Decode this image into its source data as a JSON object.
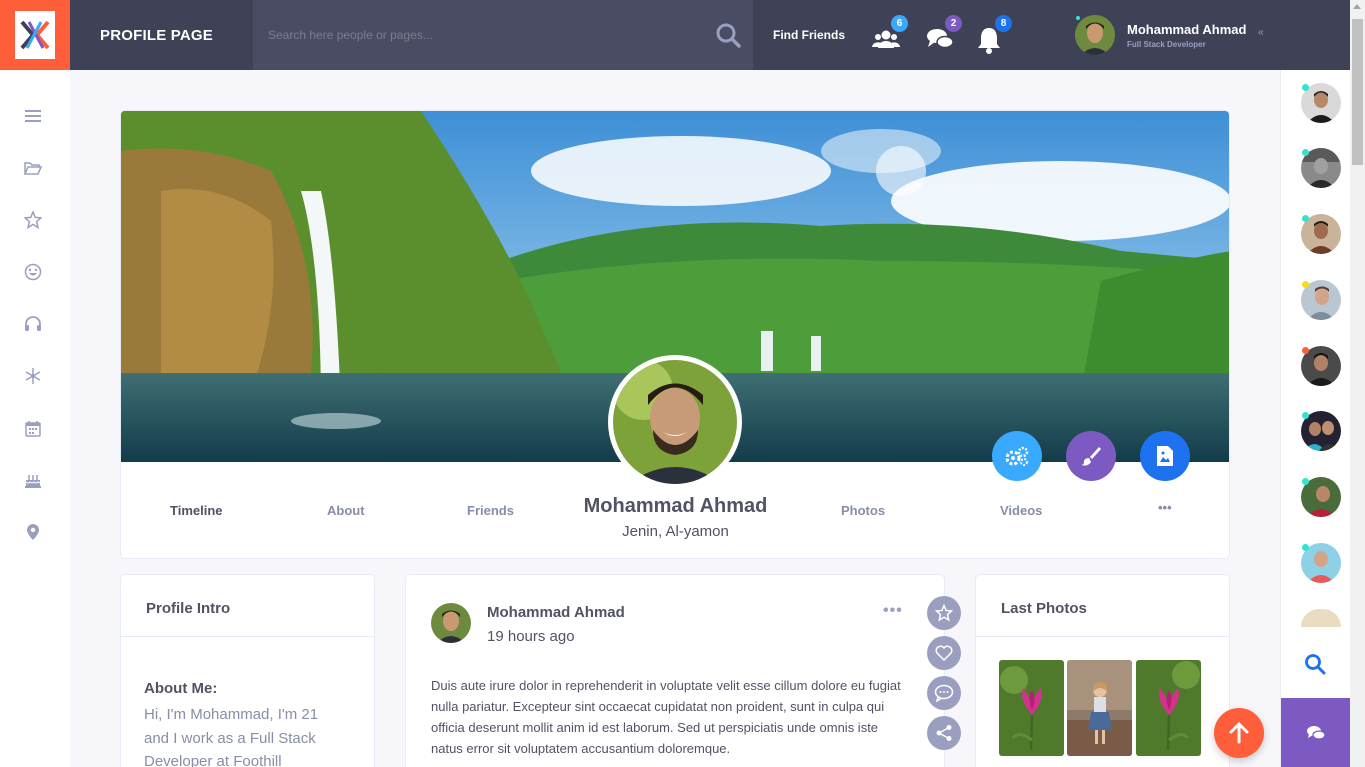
{
  "header": {
    "title": "PROFILE PAGE",
    "search_placeholder": "Search here people or pages...",
    "find_friends": "Find Friends",
    "badges": {
      "friends": "6",
      "messages": "2",
      "notifications": "8"
    },
    "user": {
      "name": "Mohammad Ahmad",
      "role": "Full Stack Developer",
      "chevron": "«"
    }
  },
  "left_sidebar": {
    "icons": [
      "menu-icon",
      "folder-icon",
      "star-icon",
      "smile-icon",
      "headphones-icon",
      "snowflake-icon",
      "calendar-icon",
      "cake-icon",
      "map-pin-icon"
    ]
  },
  "right_sidebar": {
    "status_colors": [
      "#32e4cd",
      "#32e4cd",
      "#32e4cd",
      "#ffd71b",
      "#ff5e3a",
      "#32e4cd",
      "#32e4cd",
      "#32e4cd"
    ]
  },
  "profile": {
    "name": "Mohammad Ahmad",
    "location": "Jenin, Al-yamon",
    "tabs": [
      "Timeline",
      "About",
      "Friends",
      "Photos",
      "Videos",
      "•••"
    ],
    "controls": [
      "settings-icon",
      "brush-icon",
      "image-file-icon"
    ]
  },
  "intro": {
    "title": "Profile Intro",
    "about_label": "About Me:",
    "about_text": "Hi, I'm Mohammad, I'm 21 and I work as a Full Stack Developer at Foothill"
  },
  "post": {
    "author": "Mohammad Ahmad",
    "time": "19 hours ago",
    "more": "•••",
    "text": "Duis aute irure dolor in reprehenderit in voluptate velit esse cillum dolore eu fugiat nulla pariatur. Excepteur sint occaecat cupidatat non proident, sunt in culpa qui officia deserunt mollit anim id est laborum. Sed ut perspiciatis unde omnis iste natus error sit voluptatem accusantium doloremque."
  },
  "photos": {
    "title": "Last Photos"
  },
  "colors": {
    "brand_orange": "#ff5e3a",
    "topbar": "#3f4257",
    "purple": "#7c5ac2",
    "blue": "#38a9ff",
    "navy": "#1e72f0"
  }
}
